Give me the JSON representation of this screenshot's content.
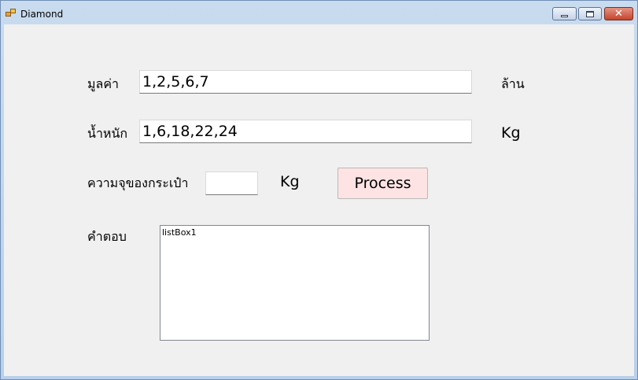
{
  "window": {
    "title": "Diamond"
  },
  "form": {
    "value_label": "มูลค่า",
    "value_input": "1,2,5,6,7",
    "value_unit": "ล้าน",
    "weight_label": "น้ำหนัก",
    "weight_input": "1,6,18,22,24",
    "weight_unit": "Kg",
    "capacity_label": "ความจุของกระเป๋า",
    "capacity_input": "",
    "capacity_unit": "Kg",
    "process_button": "Process",
    "answer_label": "คำตอบ",
    "answer_list": [
      "listBox1"
    ]
  },
  "colors": {
    "button_bg": "#fde3e3",
    "client_bg": "#f0f0f0"
  },
  "icons": [
    "app-icon",
    "minimize-icon",
    "maximize-icon",
    "close-icon"
  ]
}
